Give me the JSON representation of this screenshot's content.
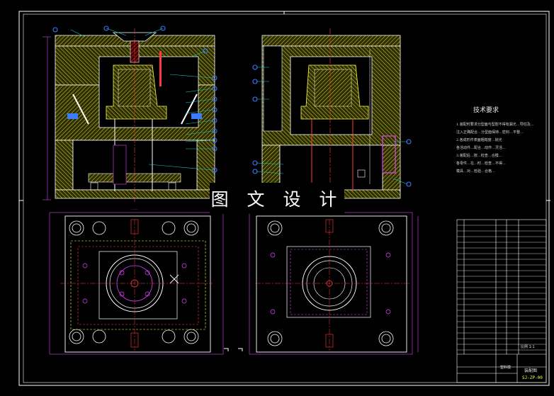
{
  "watermark": "图 文 设 计",
  "tech_requirements": {
    "title": "技术要求",
    "lines": [
      "1.装配时要求分型面与型腔不得有漏光…导柱及…",
      "注入正确配合…分型面保持…密封…平整…",
      "2.各成形件表面粗糙度…抛光",
      "各活动件…配合…动作…灵活…",
      "3.装配后…按…检查…合模…",
      "各零件…在…时…检查…不得…",
      "模具…对…检验…合格…"
    ]
  },
  "title_block": {
    "drawing_name": "装配图",
    "assembly_label": "塑料模",
    "sign_label": "比例 1:1",
    "drawing_code": "SJ-ZP-00"
  },
  "colors": {
    "outline": "#ffffff",
    "hatch": "#c8c83a",
    "leader": "#19c7c7",
    "balloon": "#3a7bff",
    "dimension": "#e040ff",
    "centerline": "#ff3b3b",
    "part_red": "#ff4040",
    "highlight": "#ffff40",
    "green": "#39d039"
  },
  "views": [
    "front-section-view",
    "side-section-view",
    "fixed-half-top-view",
    "moving-half-top-view"
  ]
}
